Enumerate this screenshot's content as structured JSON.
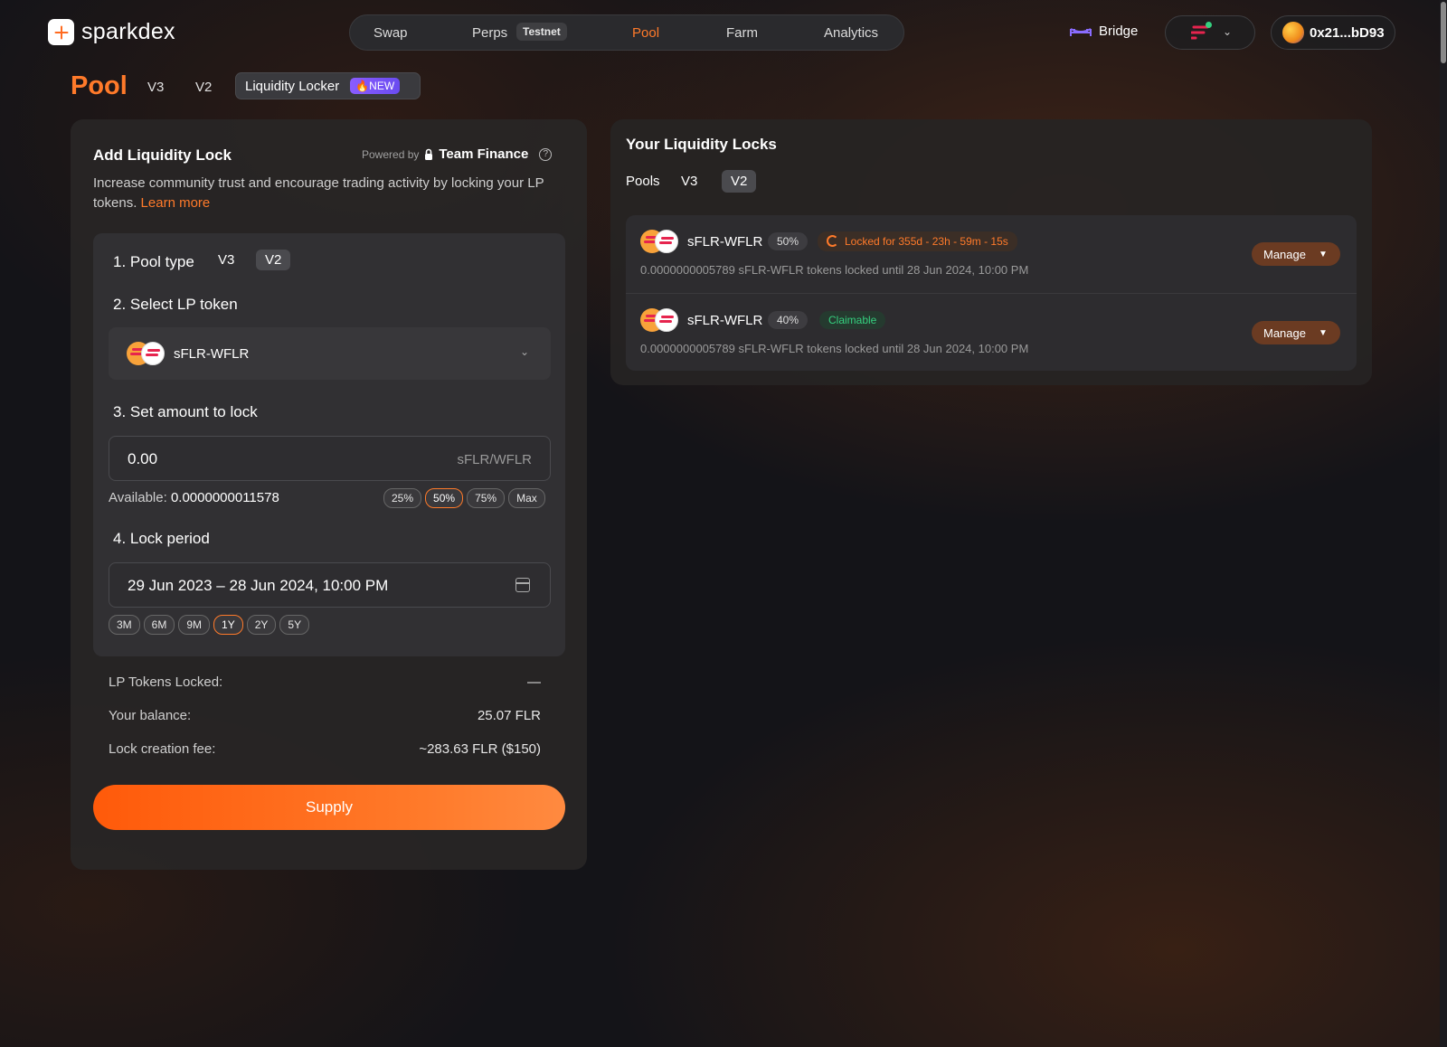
{
  "header": {
    "logo_text": "sparkdex",
    "nav": [
      {
        "label": "Swap"
      },
      {
        "label": "Perps",
        "badge": "Testnet"
      },
      {
        "label": "Pool",
        "active": true
      },
      {
        "label": "Farm"
      },
      {
        "label": "Analytics"
      }
    ],
    "bridge_label": "Bridge",
    "wallet_address": "0x21...bD93"
  },
  "subnav": {
    "title": "Pool",
    "tabs": [
      "V3",
      "V2"
    ],
    "locker_label": "Liquidity Locker",
    "new_badge": "🔥NEW"
  },
  "add_lock": {
    "title": "Add Liquidity Lock",
    "powered_by": "Powered by",
    "provider": "Team Finance",
    "description": "Increase community trust and encourage trading activity by locking your LP tokens.",
    "learn_more": "Learn more",
    "step1": "1. Pool type",
    "pool_types": [
      "V3",
      "V2"
    ],
    "step2": "2. Select LP token",
    "selected_token": "sFLR-WFLR",
    "step3": "3. Set amount to lock",
    "amount_value": "0.00",
    "amount_unit": "sFLR/WFLR",
    "available_label": "Available:",
    "available_value": "0.0000000011578",
    "amount_chips": [
      "25%",
      "50%",
      "75%",
      "Max"
    ],
    "step4": "4. Lock period",
    "period_value": "29 Jun 2023 – 28 Jun 2024, 10:00 PM",
    "period_chips": [
      "3M",
      "6M",
      "9M",
      "1Y",
      "2Y",
      "5Y"
    ],
    "info": {
      "lp_locked_label": "LP Tokens Locked:",
      "lp_locked_value": "—",
      "balance_label": "Your balance:",
      "balance_value": "25.07 FLR",
      "fee_label": "Lock creation fee:",
      "fee_value": "~283.63 FLR ($150)"
    },
    "supply_label": "Supply"
  },
  "your_locks": {
    "title": "Your Liquidity Locks",
    "tabs": [
      "Pools",
      "V3",
      "V2"
    ],
    "locks": [
      {
        "pair": "sFLR-WFLR",
        "percent": "50%",
        "status": "Locked for 355d - 23h - 59m - 15s",
        "detail": "0.0000000005789 sFLR-WFLR tokens locked until 28 Jun 2024, 10:00 PM",
        "manage": "Manage"
      },
      {
        "pair": "sFLR-WFLR",
        "percent": "40%",
        "status": "Claimable",
        "detail": "0.0000000005789 sFLR-WFLR tokens locked until 28 Jun 2024, 10:00 PM",
        "manage": "Manage"
      }
    ]
  },
  "colors": {
    "accent": "#ff7a2a",
    "claimable": "#35d07f",
    "new_badge": "#7a55f5"
  }
}
